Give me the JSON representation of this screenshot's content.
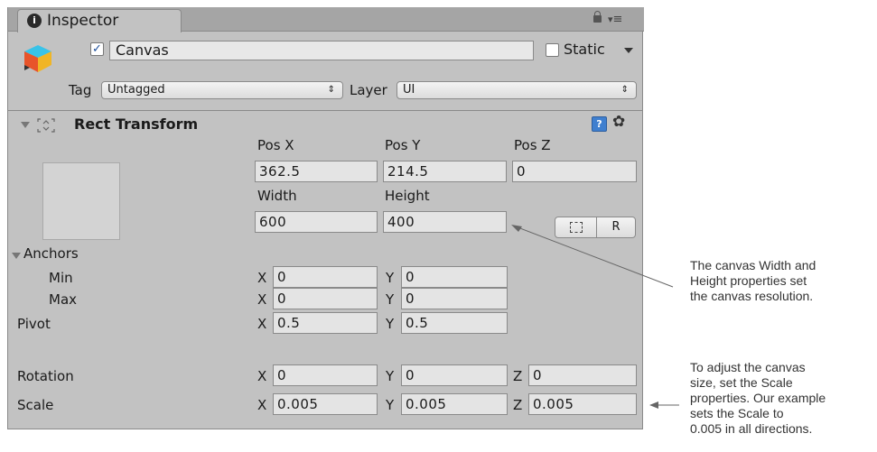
{
  "inspector": {
    "tab_label": "Inspector",
    "tab_icon": "info-icon",
    "header_icons": [
      "lock-icon",
      "menu-icon"
    ]
  },
  "game_object": {
    "icon": "cube-icon",
    "active_checked": true,
    "name": "Canvas",
    "static_label": "Static",
    "static_checked": false,
    "tag_label": "Tag",
    "tag_value": "Untagged",
    "layer_label": "Layer",
    "layer_value": "UI"
  },
  "rect_transform": {
    "title": "Rect Transform",
    "icons": [
      "rect-transform-icon",
      "help-book-icon",
      "gear-icon"
    ],
    "pos_x_label": "Pos X",
    "pos_y_label": "Pos Y",
    "pos_z_label": "Pos Z",
    "pos_x": "362.5",
    "pos_y": "214.5",
    "pos_z": "0",
    "width_label": "Width",
    "height_label": "Height",
    "width": "600",
    "height": "400",
    "blueprint_button": "[ ]",
    "raw_button": "R",
    "anchors_label": "Anchors",
    "min_label": "Min",
    "max_label": "Max",
    "anchor_min_x": "0",
    "anchor_min_y": "0",
    "anchor_max_x": "0",
    "anchor_max_y": "0",
    "pivot_label": "Pivot",
    "pivot_x": "0.5",
    "pivot_y": "0.5",
    "rotation_label": "Rotation",
    "rotation_x": "0",
    "rotation_y": "0",
    "rotation_z": "0",
    "scale_label": "Scale",
    "scale_x": "0.005",
    "scale_y": "0.005",
    "scale_z": "0.005",
    "axis_x": "X",
    "axis_y": "Y",
    "axis_z": "Z"
  },
  "annotations": {
    "resolution": [
      "The canvas Width and",
      "Height properties set",
      "the canvas resolution."
    ],
    "scale": [
      "To adjust the canvas",
      "size, set the Scale",
      "properties. Our example",
      "sets the Scale to",
      "0.005 in all directions."
    ]
  }
}
